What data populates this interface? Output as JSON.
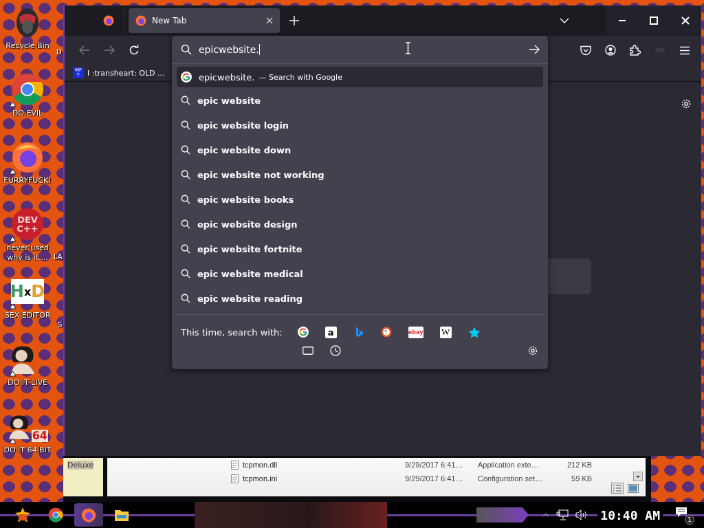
{
  "desktop": {
    "icons": [
      {
        "kind": "helmet",
        "label": "Recycle Bin",
        "shortcut": false
      },
      {
        "kind": "chrome",
        "label": "DO EVIL",
        "shortcut": true
      },
      {
        "kind": "firefox",
        "label": "FURRYFUCK!",
        "shortcut": true
      },
      {
        "kind": "devcpp",
        "label": "never used why is it ...",
        "icon_text": [
          "DEV",
          "C++"
        ],
        "shortcut": true
      },
      {
        "kind": "hxd",
        "label": "SEX EDITOR",
        "icon_text": [
          "H",
          "x",
          "D"
        ],
        "shortcut": true
      },
      {
        "kind": "figure",
        "label": "DO IT LIVE",
        "shortcut": true
      },
      {
        "kind": "figure",
        "label": "DO IT 64 BIT",
        "icon_text": [
          "64"
        ],
        "shortcut": true
      }
    ],
    "cut_labels": [
      "D",
      "LA",
      "S"
    ]
  },
  "explorer": {
    "cut_label": "Deluxe",
    "files": [
      {
        "name": "tcpmon.dll",
        "date": "9/29/2017 6:41…",
        "type": "Application exte…",
        "size": "212 KB"
      },
      {
        "name": "tcpmon.ini",
        "date": "9/29/2017 6:41…",
        "type": "Configuration set…",
        "size": "59 KB"
      }
    ]
  },
  "browser": {
    "tabs": [
      {
        "kind": "pinned",
        "selected": false
      },
      {
        "kind": "page",
        "label": "New Tab",
        "selected": true
      }
    ],
    "urlbar": {
      "value": "epicwebsite."
    },
    "bookmarks": [
      {
        "favicon_text": [
          "MF",
          "T"
        ],
        "label": "I :transheart: OLD ..."
      }
    ],
    "results": [
      {
        "kind": "search",
        "text": "epicwebsite.",
        "action": "— Search with Google",
        "selected": true
      },
      {
        "kind": "suggestion",
        "text": "epic website",
        "selected": false
      },
      {
        "kind": "suggestion",
        "text": "epic website login",
        "selected": false
      },
      {
        "kind": "suggestion",
        "text": "epic website down",
        "selected": false
      },
      {
        "kind": "suggestion",
        "text": "epic website not working",
        "selected": false
      },
      {
        "kind": "suggestion",
        "text": "epic website books",
        "selected": false
      },
      {
        "kind": "suggestion",
        "text": "epic website design",
        "selected": false
      },
      {
        "kind": "suggestion",
        "text": "epic website fortnite",
        "selected": false
      },
      {
        "kind": "suggestion",
        "text": "epic website medical",
        "selected": false
      },
      {
        "kind": "suggestion",
        "text": "epic website reading",
        "selected": false
      }
    ],
    "one_offs": {
      "label": "This time, search with:",
      "engines": [
        {
          "kind": "google"
        },
        {
          "kind": "amazon",
          "glyph": "a"
        },
        {
          "kind": "bing"
        },
        {
          "kind": "duckduckgo"
        },
        {
          "kind": "ebay",
          "glyph": "ebay"
        },
        {
          "kind": "wikipedia",
          "glyph": "W"
        },
        {
          "kind": "bookmarks"
        }
      ],
      "modes": [
        {
          "kind": "tabs"
        },
        {
          "kind": "history"
        }
      ]
    }
  },
  "taskbar": {
    "apps": [
      {
        "kind": "start",
        "selected": false
      },
      {
        "kind": "chrome",
        "selected": false
      },
      {
        "kind": "firefox",
        "selected": true
      },
      {
        "kind": "explorer",
        "selected": false
      }
    ],
    "clock": "10:40 AM",
    "notification_count": "1"
  }
}
